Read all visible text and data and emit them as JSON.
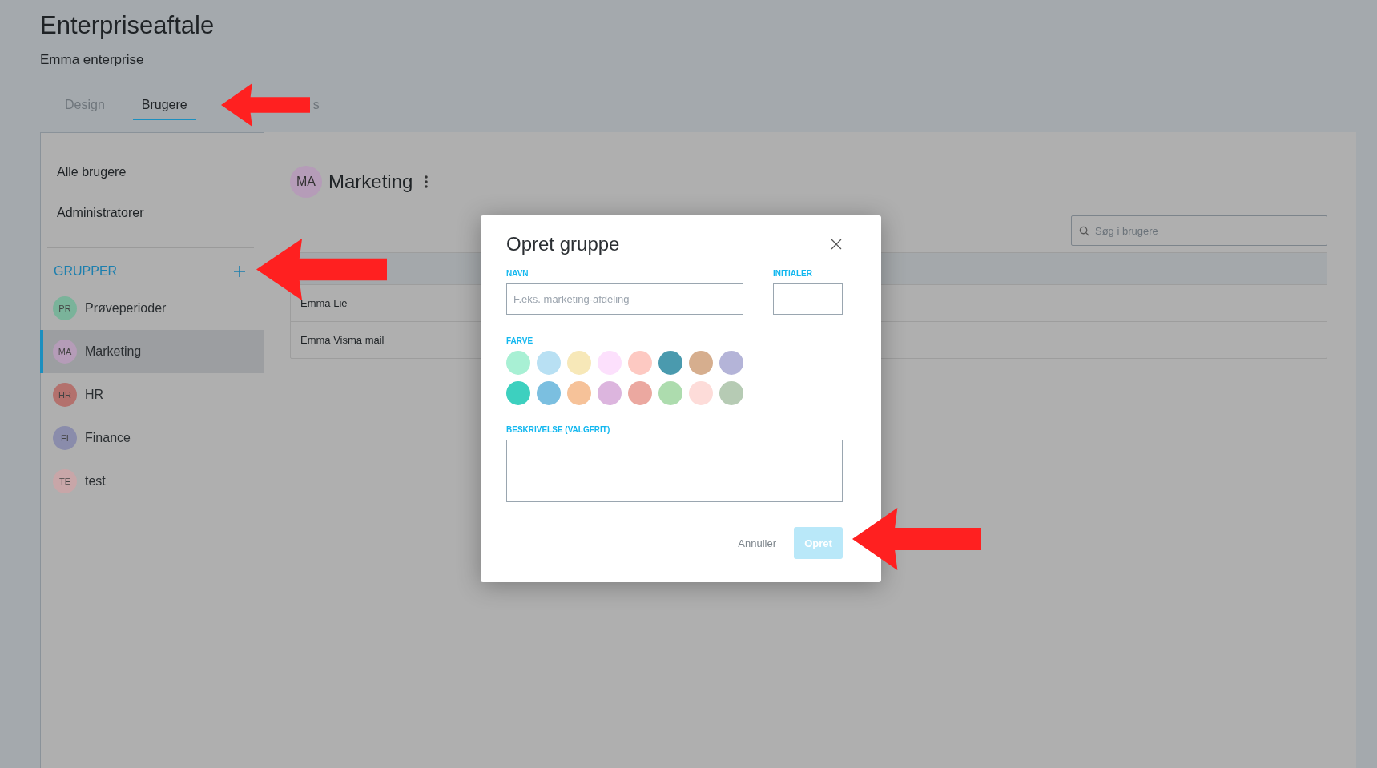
{
  "page": {
    "title": "Enterpriseaftale",
    "subtitle": "Emma enterprise"
  },
  "tabs": [
    {
      "label": "Design",
      "selected": false
    },
    {
      "label": "Brugere",
      "selected": true
    },
    {
      "label": "s",
      "selected": false
    }
  ],
  "sidebar": {
    "items": [
      {
        "label": "Alle brugere"
      },
      {
        "label": "Administratorer"
      }
    ],
    "groups_heading": "GRUPPER",
    "groups": [
      {
        "initials": "PR",
        "label": "Prøveperioder",
        "color": "#7ab39a",
        "selected": false
      },
      {
        "initials": "MA",
        "label": "Marketing",
        "color": "#b59cb8",
        "selected": true
      },
      {
        "initials": "HR",
        "label": "HR",
        "color": "#b3716d",
        "selected": false
      },
      {
        "initials": "FI",
        "label": "Finance",
        "color": "#8a8cab",
        "selected": false
      },
      {
        "initials": "TE",
        "label": "test",
        "color": "#c8a6a8",
        "selected": false
      }
    ]
  },
  "group_header": {
    "initials": "MA",
    "title": "Marketing"
  },
  "search": {
    "placeholder": "Søg i brugere"
  },
  "table": {
    "rows": [
      {
        "name": "Emma Lie"
      },
      {
        "name": "Emma Visma mail"
      }
    ]
  },
  "dialog": {
    "title": "Opret gruppe",
    "name_label": "NAVN",
    "name_placeholder": "F.eks. marketing-afdeling",
    "initials_label": "INITIALER",
    "color_label": "FARVE",
    "colors": [
      {
        "color": "#a8f0d4"
      },
      {
        "color": "#b8e0f3"
      },
      {
        "color": "#f7e8b8"
      },
      {
        "color": "#fce0fc"
      },
      {
        "color": "#fdc9c2"
      },
      {
        "color": "#4a9aae"
      },
      {
        "color": "#d6ae8e"
      },
      {
        "color": "#b4b4d8"
      },
      {
        "color": "#3dd0bf"
      },
      {
        "color": "#7bbfe0"
      },
      {
        "color": "#f6c299"
      },
      {
        "color": "#dcb5de"
      },
      {
        "color": "#eba8a0"
      },
      {
        "color": "#addcae"
      },
      {
        "color": "#fddcd9"
      },
      {
        "color": "#b6cbb4"
      }
    ],
    "description_label": "BESKRIVELSE (VALGFRIT)",
    "cancel": "Annuller",
    "submit": "Opret",
    "submit_disabled": true
  }
}
